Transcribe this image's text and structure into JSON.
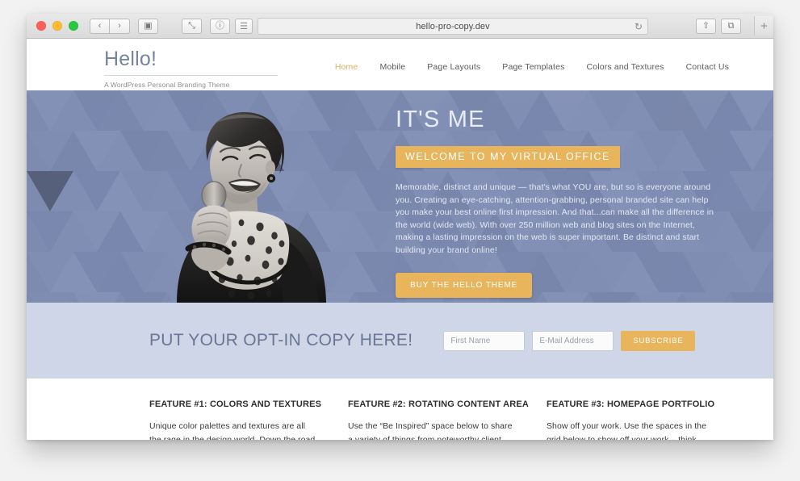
{
  "browser": {
    "url": "hello-pro-copy.dev",
    "traffic_lights": [
      "close",
      "minimize",
      "zoom"
    ],
    "back_icon": "‹",
    "forward_icon": "›",
    "sidebar_icon": "▣",
    "tabs_overview_icon": "⤡",
    "history_icon": "ⓘ",
    "reader_icon": "☰",
    "reload_icon": "↻",
    "share_icon": "⇧",
    "show_tabs_icon": "⧉",
    "new_tab_icon": "+"
  },
  "site": {
    "title": "Hello!",
    "tagline": "A WordPress Personal Branding Theme",
    "nav": [
      {
        "label": "Home",
        "active": true
      },
      {
        "label": "Mobile",
        "active": false
      },
      {
        "label": "Page Layouts",
        "active": false
      },
      {
        "label": "Page Templates",
        "active": false
      },
      {
        "label": "Colors and Textures",
        "active": false
      },
      {
        "label": "Contact Us",
        "active": false
      }
    ]
  },
  "hero": {
    "heading": "IT'S ME",
    "badge": "WELCOME TO MY VIRTUAL OFFICE",
    "paragraph": "Memorable, distinct and unique — that's what YOU are, but so is everyone around you. Creating an eye-catching, attention-grabbing, personal branded site can help you make your best online first impression. And that...can make all the difference in the world (wide web). With over 250 million web and blog sites on the Internet, making a lasting impression on the web is super important. Be distinct and start building your brand online!",
    "cta_label": "BUY THE HELLO THEME",
    "photo_alt": "Smiling woman holding a microphone"
  },
  "optin": {
    "heading": "PUT YOUR OPT-IN COPY HERE!",
    "first_name_placeholder": "First Name",
    "email_placeholder": "E-Mail Address",
    "first_name_value": "",
    "email_value": "",
    "subscribe_label": "SUBSCRIBE"
  },
  "features": [
    {
      "title": "FEATURE #1: COLORS AND TEXTURES",
      "body": "Unique color palettes and textures are all the rage in the design world. Down the road if"
    },
    {
      "title": "FEATURE #2: ROTATING CONTENT AREA",
      "body": "Use the “Be Inspired” space below to share a variety of things from noteworthy client"
    },
    {
      "title": "FEATURE #3: HOMEPAGE PORTFOLIO",
      "body": "Show off your work. Use the spaces in the grid below to show off your work – think"
    }
  ],
  "colors": {
    "accent_gold": "#e8b55c",
    "hero_blue": "#7e8bb1",
    "optin_lavender": "#ced6e7",
    "brand_text": "#74849f"
  }
}
